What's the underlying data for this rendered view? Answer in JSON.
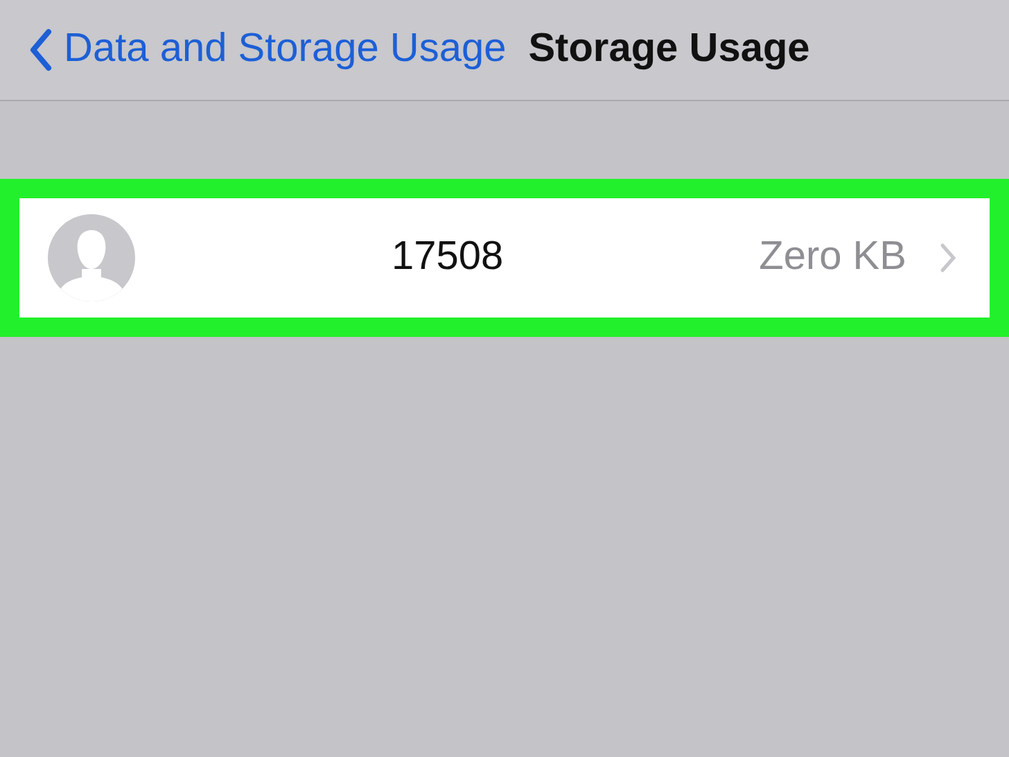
{
  "nav_bar": {
    "back_label": "Data and Storage Usage",
    "title": "Storage Usage"
  },
  "rows": [
    {
      "name": "17508",
      "size": "Zero KB",
      "highlighted": true
    }
  ]
}
